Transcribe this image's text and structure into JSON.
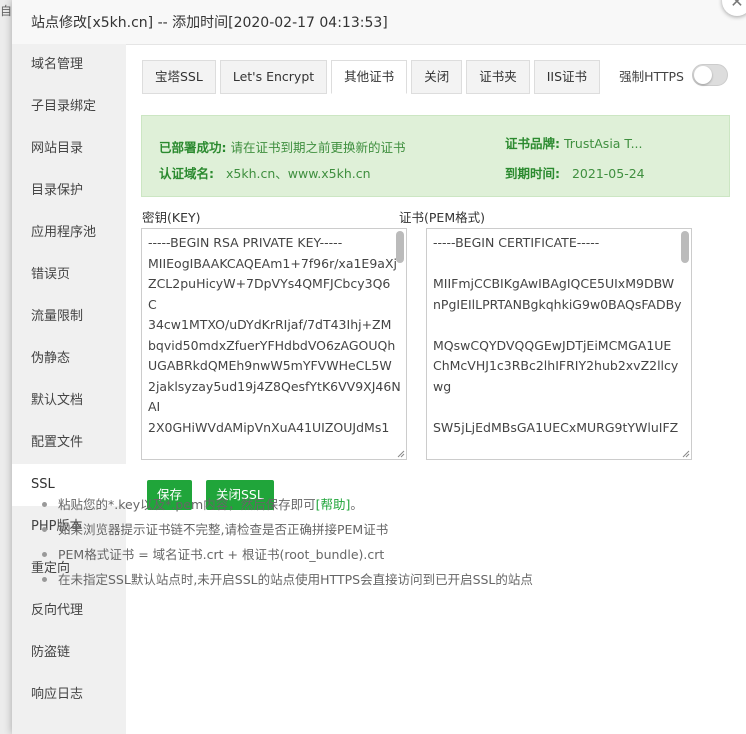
{
  "background": {
    "partial_text": "自"
  },
  "dialog": {
    "title": "站点修改[x5kh.cn] -- 添加时间[2020-02-17 04:13:53]"
  },
  "sidebar": {
    "items": [
      {
        "label": "域名管理"
      },
      {
        "label": "子目录绑定"
      },
      {
        "label": "网站目录"
      },
      {
        "label": "目录保护"
      },
      {
        "label": "应用程序池"
      },
      {
        "label": "错误页"
      },
      {
        "label": "流量限制"
      },
      {
        "label": "伪静态"
      },
      {
        "label": "默认文档"
      },
      {
        "label": "配置文件"
      },
      {
        "label": "SSL"
      },
      {
        "label": "PHP版本"
      },
      {
        "label": "重定向"
      },
      {
        "label": "反向代理"
      },
      {
        "label": "防盗链"
      },
      {
        "label": "响应日志"
      }
    ],
    "active": "SSL"
  },
  "tabs": [
    {
      "label": "宝塔SSL"
    },
    {
      "label": "Let's Encrypt"
    },
    {
      "label": "其他证书"
    },
    {
      "label": "关闭"
    },
    {
      "label": "证书夹"
    },
    {
      "label": "IIS证书"
    }
  ],
  "active_tab": "其他证书",
  "force_https": {
    "label": "强制HTTPS",
    "enabled": false
  },
  "status": {
    "deploy_label": "已部署成功:",
    "deploy_text": "请在证书到期之前更换新的证书",
    "domain_label": "认证域名:",
    "domain_value": "x5kh.cn、www.x5kh.cn",
    "brand_label": "证书品牌:",
    "brand_value": "TrustAsia T...",
    "expiry_label": "到期时间:",
    "expiry_value": "2021-05-24"
  },
  "key": {
    "label": "密钥(KEY)",
    "lines": [
      "-----BEGIN RSA PRIVATE KEY-----",
      "MIIEogIBAAKCAQEAm1+7f96r/xa1E9aXj",
      "ZCL2puHicyW+7DpVYs4QMFJCbcy3Q6",
      "C",
      "34cw1MTXO/uDYdKrRIjaf/7dT43Ihj+ZM",
      "bqvid50mdxZfuerYFHdbdVO6zAGOUQh",
      "UGABRkdQMEh9nwW5mYFVWHeCL5W",
      "2jaklsyzay5ud19j4Z8QesfYtK6VV9XJ46N",
      "AI",
      "2X0GHiWVdAMipVnXuA41UIZOUJdMs1"
    ]
  },
  "cert": {
    "label": "证书(PEM格式)",
    "lines": [
      "-----BEGIN CERTIFICATE-----",
      "",
      "MIIFmjCCBIKgAwIBAgIQCE5UIxM9DBW",
      "nPgIEIlLPRTANBgkqhkiG9w0BAQsFADBy",
      "",
      "MQswCQYDVQQGEwJDTjEiMCMGA1UE",
      "ChMcVHJ1c3RBc2lhIFRIY2hub2xvZ2llcy",
      "wg",
      "",
      "SW5jLjEdMBsGA1UECxMURG9tYWluIFZ"
    ]
  },
  "buttons": {
    "save": "保存",
    "close_ssl": "关闭SSL"
  },
  "notes": {
    "n1_prefix": "粘贴您的*.key以及*.pem内容，然后保存即可",
    "n1_link": "[帮助]",
    "n1_suffix": "。",
    "n2": "如果浏览器提示证书链不完整,请检查是否正确拼接PEM证书",
    "n3": "PEM格式证书 = 域名证书.crt + 根证书(root_bundle).crt",
    "n4": "在未指定SSL默认站点时,未开启SSL的站点使用HTTPS会直接访问到已开启SSL的站点"
  },
  "colors": {
    "accent": "#20a53a",
    "status_bg": "#dff0d8",
    "status_text": "#2b8a2f"
  }
}
